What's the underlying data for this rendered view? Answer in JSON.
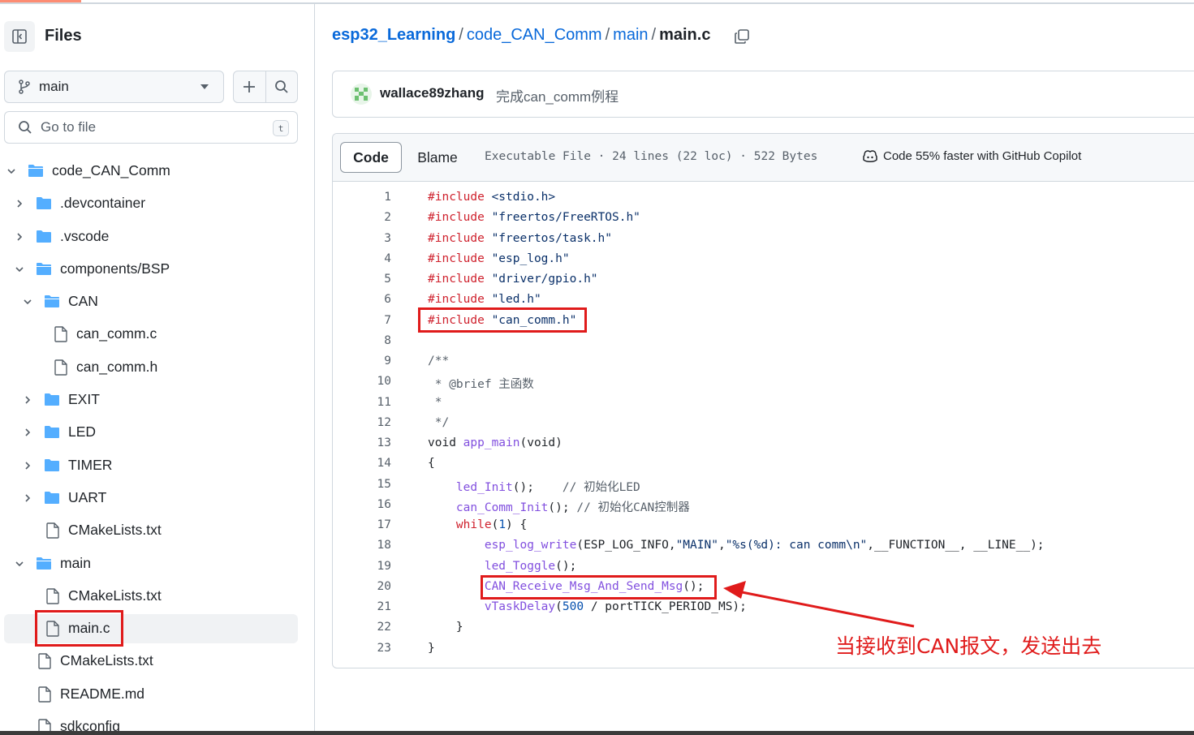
{
  "sidebar": {
    "title": "Files",
    "branch": "main",
    "goto_placeholder": "Go to file",
    "goto_shortcut": "t",
    "tree": [
      {
        "label": "code_CAN_Comm",
        "type": "folder",
        "depth": 0,
        "expanded": true
      },
      {
        "label": ".devcontainer",
        "type": "folder",
        "depth": 1,
        "expanded": false
      },
      {
        "label": ".vscode",
        "type": "folder",
        "depth": 1,
        "expanded": false
      },
      {
        "label": "components/BSP",
        "type": "folder",
        "depth": 1,
        "expanded": true
      },
      {
        "label": "CAN",
        "type": "folder",
        "depth": 2,
        "expanded": true
      },
      {
        "label": "can_comm.c",
        "type": "file",
        "depth": 3
      },
      {
        "label": "can_comm.h",
        "type": "file",
        "depth": 3
      },
      {
        "label": "EXIT",
        "type": "folder",
        "depth": 2,
        "expanded": false
      },
      {
        "label": "LED",
        "type": "folder",
        "depth": 2,
        "expanded": false
      },
      {
        "label": "TIMER",
        "type": "folder",
        "depth": 2,
        "expanded": false
      },
      {
        "label": "UART",
        "type": "folder",
        "depth": 2,
        "expanded": false
      },
      {
        "label": "CMakeLists.txt",
        "type": "file",
        "depth": 2
      },
      {
        "label": "main",
        "type": "folder",
        "depth": 1,
        "expanded": true
      },
      {
        "label": "CMakeLists.txt",
        "type": "file",
        "depth": 2
      },
      {
        "label": "main.c",
        "type": "file",
        "depth": 2,
        "selected": true
      },
      {
        "label": "CMakeLists.txt",
        "type": "file",
        "depth": 1
      },
      {
        "label": "README.md",
        "type": "file",
        "depth": 1
      },
      {
        "label": "sdkconfig",
        "type": "file",
        "depth": 1
      }
    ]
  },
  "breadcrumb": {
    "repo": "esp32_Learning",
    "parts": [
      "code_CAN_Comm",
      "main"
    ],
    "current": "main.c",
    "sep": "/"
  },
  "commit": {
    "user": "wallace89zhang",
    "message": "完成can_comm例程"
  },
  "file": {
    "tabs": {
      "code": "Code",
      "blame": "Blame"
    },
    "meta": "Executable File · 24 lines (22 loc) · 522 Bytes",
    "copilot": "Code 55% faster with GitHub Copilot"
  },
  "code_lines": [
    "#include <stdio.h>",
    "#include \"freertos/FreeRTOS.h\"",
    "#include \"freertos/task.h\"",
    "#include \"esp_log.h\"",
    "#include \"driver/gpio.h\"",
    "#include \"led.h\"",
    "#include \"can_comm.h\"",
    "",
    "/**",
    " * @brief 主函数",
    " *",
    " */",
    "void app_main(void)",
    "{",
    "    led_Init();    // 初始化LED",
    "    can_Comm_Init(); // 初始化CAN控制器",
    "    while(1) {",
    "        esp_log_write(ESP_LOG_INFO,\"MAIN\",\"%s(%d): can comm\\n\",__FUNCTION__, __LINE__);",
    "        led_Toggle();",
    "        CAN_Receive_Msg_And_Send_Msg();",
    "        vTaskDelay(500 / portTICK_PERIOD_MS);",
    "    }",
    "}"
  ],
  "annotation": {
    "text": "当接收到CAN报文，发送出去"
  },
  "colors": {
    "link": "#0969da",
    "keyword": "#cf222e",
    "string": "#0a3069",
    "function": "#8250df",
    "comment": "#57606a",
    "annotation_red": "#e01b1b"
  }
}
